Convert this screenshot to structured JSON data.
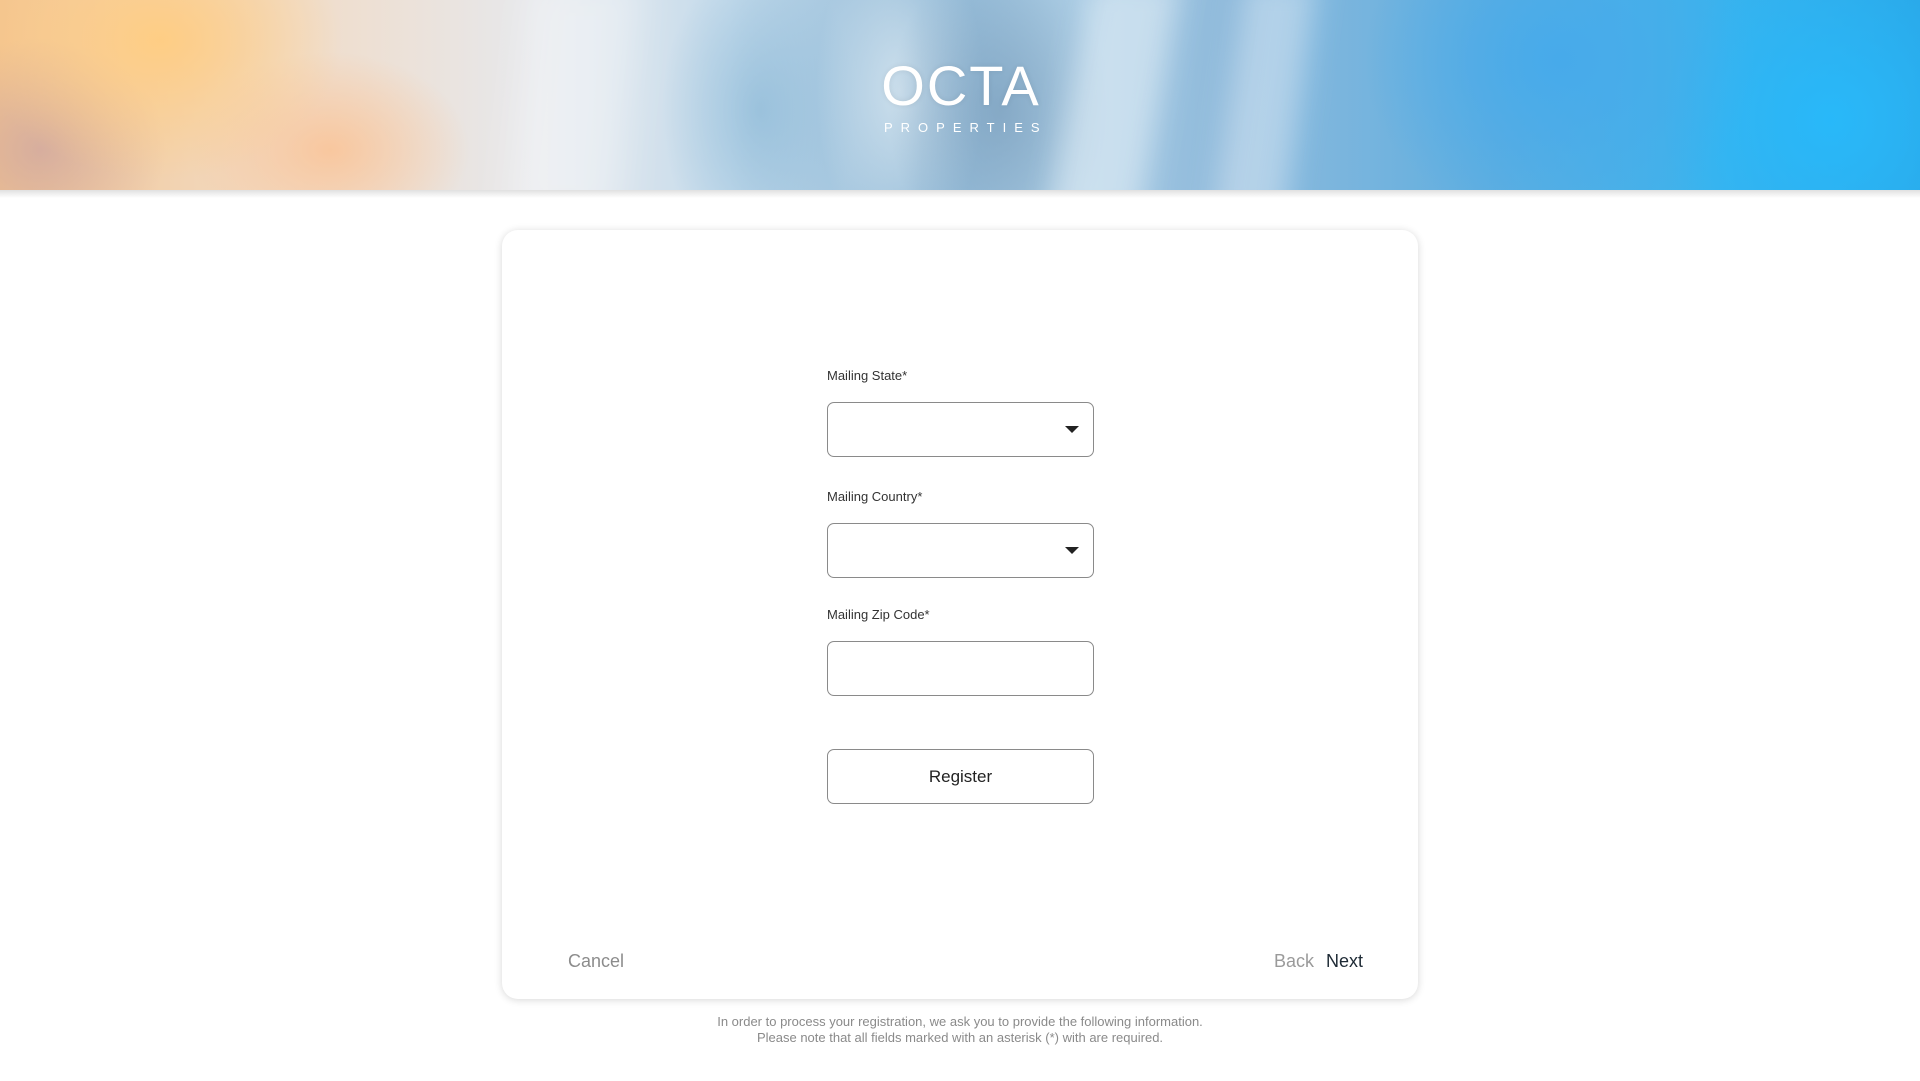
{
  "brand": {
    "wordmark": "OCTA",
    "subtitle": "PROPERTIES"
  },
  "form": {
    "mailing_state": {
      "label": "Mailing State*",
      "value": ""
    },
    "mailing_country": {
      "label": "Mailing Country*",
      "value": ""
    },
    "mailing_zip": {
      "label": "Mailing Zip Code*",
      "value": ""
    },
    "register_label": "Register"
  },
  "nav": {
    "cancel_label": "Cancel",
    "back_label": "Back",
    "next_label": "Next"
  },
  "footer": {
    "line1": "In order to process your registration, we ask you to provide the following information.",
    "line2": "Please note that all fields marked with an asterisk (*) with are required."
  },
  "icons": {
    "dropdown": "caret-down-icon"
  }
}
